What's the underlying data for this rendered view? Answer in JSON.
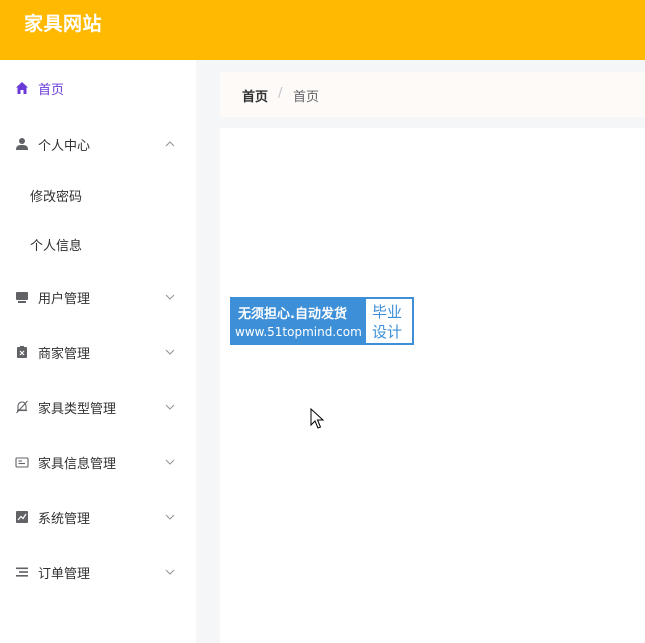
{
  "header": {
    "title": "家具网站"
  },
  "sidebar": {
    "items": [
      {
        "label": "首页",
        "icon": "home-icon",
        "active": true
      },
      {
        "label": "个人中心",
        "icon": "user-icon",
        "expanded": true,
        "children": [
          {
            "label": "修改密码"
          },
          {
            "label": "个人信息"
          }
        ]
      },
      {
        "label": "用户管理",
        "icon": "monitor-icon"
      },
      {
        "label": "商家管理",
        "icon": "clipboard-icon"
      },
      {
        "label": "家具类型管理",
        "icon": "bell-off-icon"
      },
      {
        "label": "家具信息管理",
        "icon": "id-card-icon"
      },
      {
        "label": "系统管理",
        "icon": "chart-icon"
      },
      {
        "label": "订单管理",
        "icon": "list-icon"
      }
    ]
  },
  "breadcrumb": {
    "root": "首页",
    "separator": "/",
    "current": "首页"
  },
  "watermark": {
    "line1": "无须担心.自动发货",
    "line2": "www.51topmind.com",
    "right1": "毕业",
    "right2": "设计"
  },
  "colors": {
    "header": "#ffb900",
    "active": "#6a3bd8",
    "watermark": "#3d8fd8"
  }
}
